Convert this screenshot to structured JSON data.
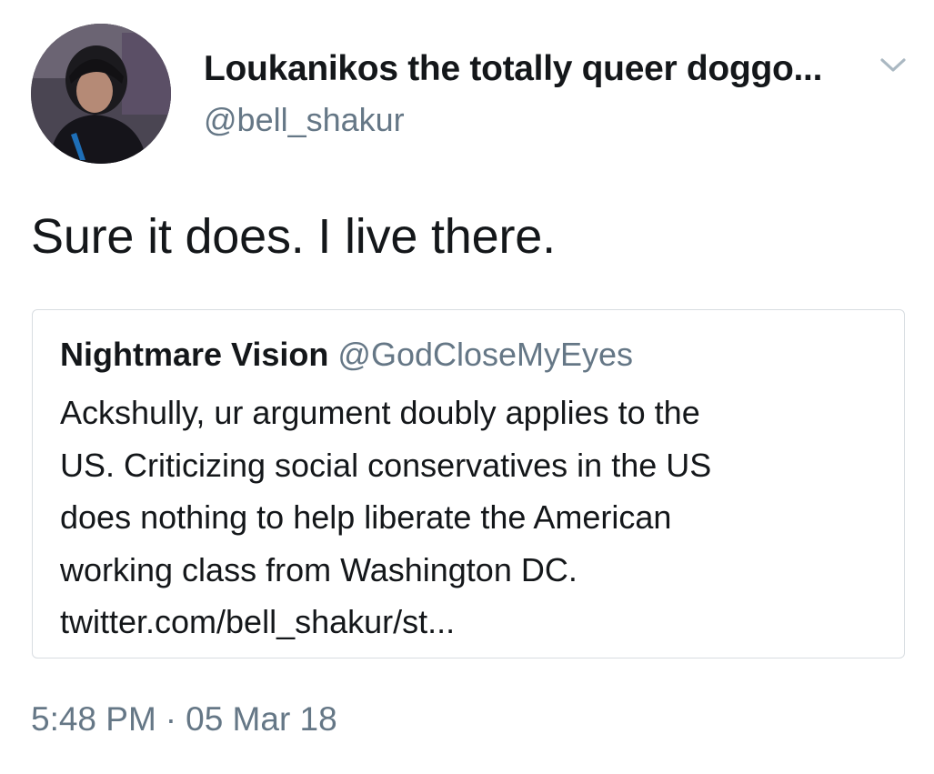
{
  "tweet": {
    "author": {
      "display_name": "Loukanikos the totally queer doggo...",
      "handle": "@bell_shakur",
      "avatar_icon": "profile-photo"
    },
    "menu_icon": "chevron-down-icon",
    "text": "Sure it does. I live there.",
    "quoted_tweet": {
      "display_name": "Nightmare Vision",
      "handle": "@GodCloseMyEyes",
      "lines": [
        "Ackshully, ur argument doubly applies to the",
        "US. Criticizing social conservatives in the US",
        "does nothing to help liberate the American",
        "working class from Washington DC.",
        "twitter.com/bell_shakur/st..."
      ]
    },
    "time": "5:48 PM",
    "separator": "·",
    "date": "05 Mar 18"
  },
  "colors": {
    "primary_text": "#14171a",
    "secondary_text": "#657786",
    "border": "#d8dde1"
  }
}
